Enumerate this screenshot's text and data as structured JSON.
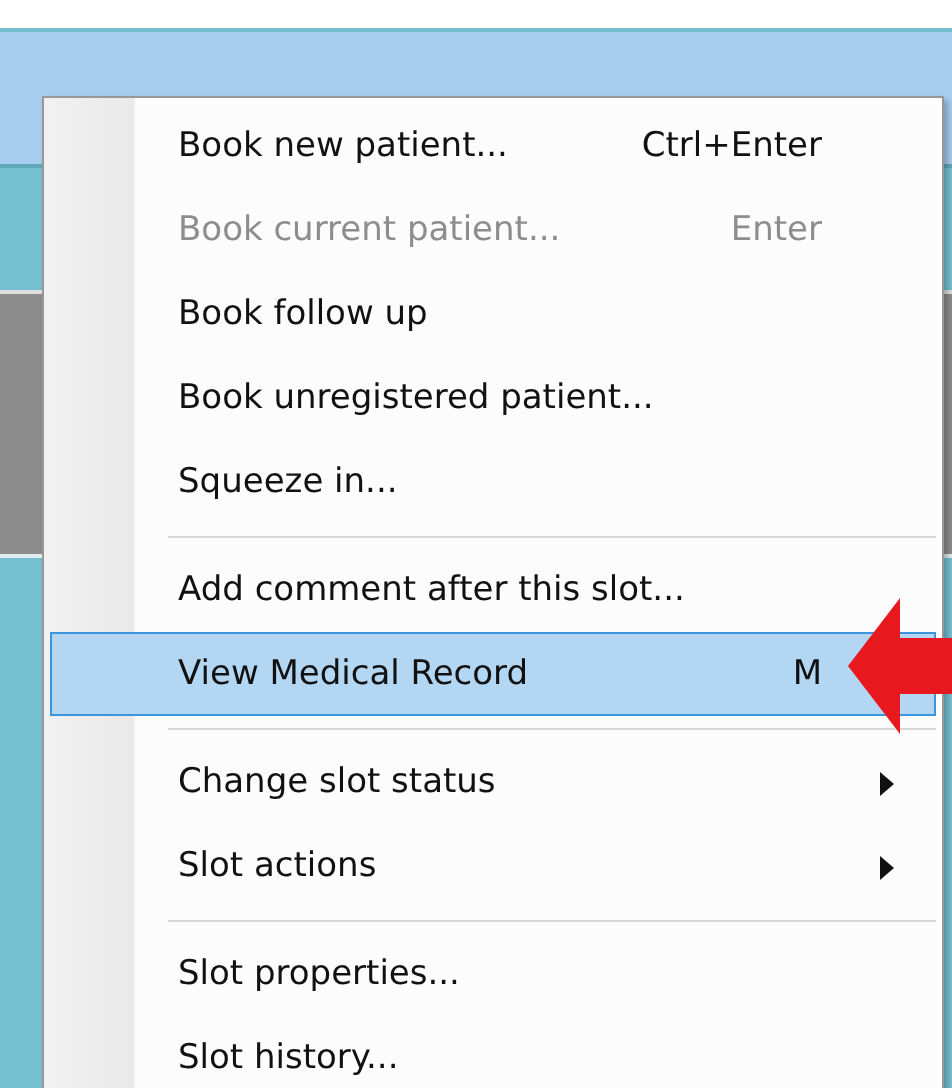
{
  "context_menu": {
    "items": [
      {
        "kind": "item",
        "label": "Book new patient...",
        "shortcut": "Ctrl+Enter",
        "disabled": false,
        "selected": false,
        "submenu": false
      },
      {
        "kind": "item",
        "label": "Book current patient...",
        "shortcut": "Enter",
        "disabled": true,
        "selected": false,
        "submenu": false
      },
      {
        "kind": "item",
        "label": "Book follow up",
        "disabled": false,
        "selected": false,
        "submenu": false
      },
      {
        "kind": "item",
        "label": "Book unregistered patient...",
        "disabled": false,
        "selected": false,
        "submenu": false
      },
      {
        "kind": "item",
        "label": "Squeeze in...",
        "disabled": false,
        "selected": false,
        "submenu": false
      },
      {
        "kind": "separator"
      },
      {
        "kind": "item",
        "label": "Add comment after this slot...",
        "disabled": false,
        "selected": false,
        "submenu": false
      },
      {
        "kind": "item",
        "label": "View Medical Record",
        "shortcut": "M",
        "disabled": false,
        "selected": true,
        "submenu": false
      },
      {
        "kind": "separator"
      },
      {
        "kind": "item",
        "label": "Change slot status",
        "disabled": false,
        "selected": false,
        "submenu": true
      },
      {
        "kind": "item",
        "label": "Slot actions",
        "disabled": false,
        "selected": false,
        "submenu": true
      },
      {
        "kind": "separator"
      },
      {
        "kind": "item",
        "label": "Slot properties...",
        "disabled": false,
        "selected": false,
        "submenu": false
      },
      {
        "kind": "item",
        "label": "Slot history...",
        "disabled": false,
        "selected": false,
        "submenu": false
      }
    ]
  }
}
